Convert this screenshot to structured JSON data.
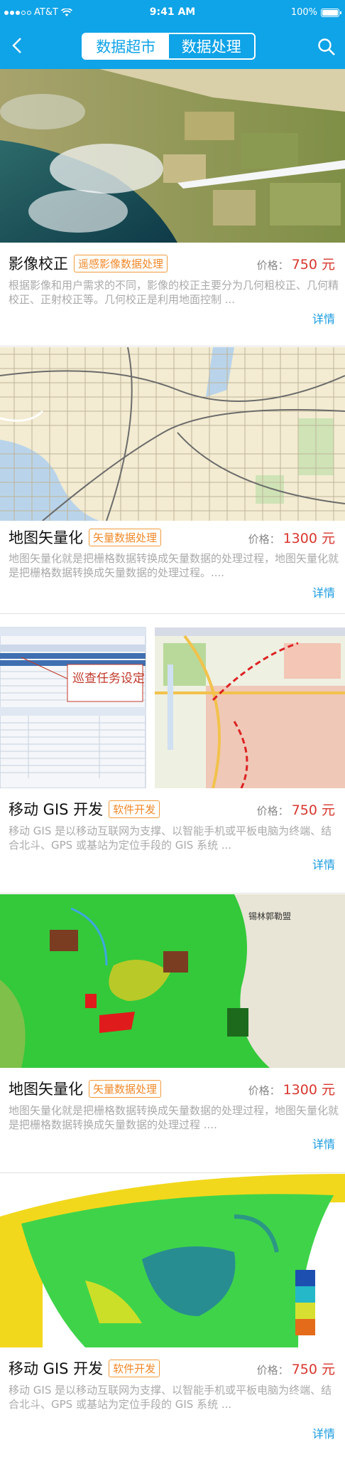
{
  "status": {
    "carrier": "AT&T",
    "time": "9:41 AM",
    "battery": "100%"
  },
  "nav": {
    "back_glyph": "‹",
    "tabs": [
      "数据超市",
      "数据处理"
    ],
    "active_tab": 0,
    "search_icon": "search-icon"
  },
  "cards": [
    {
      "title": "影像校正",
      "tag": "遥感影像数据处理",
      "price_label": "价格：",
      "price": "750 元",
      "desc": "根据影像和用户需求的不同，影像的校正主要分为几何粗校正、几何精校正、正射校正等。几何校正是利用地面控制 ...",
      "detail": "详情"
    },
    {
      "title": "地图矢量化",
      "tag": "矢量数据处理",
      "price_label": "价格：",
      "price": "1300 元",
      "desc": "地图矢量化就是把栅格数据转换成矢量数据的处理过程，地图矢量化就是把栅格数据转换成矢量数据的处理过程。....",
      "detail": "详情"
    },
    {
      "title": "移动 GIS 开发",
      "tag": "软件开发",
      "price_label": "价格：",
      "price": "750 元",
      "desc": "移动 GIS 是以移动互联网为支撑、以智能手机或平板电脑为终端、结合北斗、GPS 或基站为定位手段的 GIS 系统 ...",
      "detail": "详情",
      "image_callout": "巡查任务设定"
    },
    {
      "title": "地图矢量化",
      "tag": "矢量数据处理",
      "price_label": "价格：",
      "price": "1300 元",
      "desc": "地图矢量化就是把栅格数据转换成矢量数据的处理过程，地图矢量化就是把栅格数据转换成矢量数据的处理过程 ....",
      "detail": "详情",
      "image_label": "锡林郭勒盟"
    },
    {
      "title": "移动 GIS 开发",
      "tag": "软件开发",
      "price_label": "价格：",
      "price": "750 元",
      "desc": "移动 GIS 是以移动互联网为支撑、以智能手机或平板电脑为终端、结合北斗、GPS 或基站为定位手段的 GIS 系统 ...",
      "detail": "详情"
    }
  ],
  "colors": {
    "accent": "#0fa3e7",
    "price": "#d8362e",
    "tag": "#f0892a"
  }
}
